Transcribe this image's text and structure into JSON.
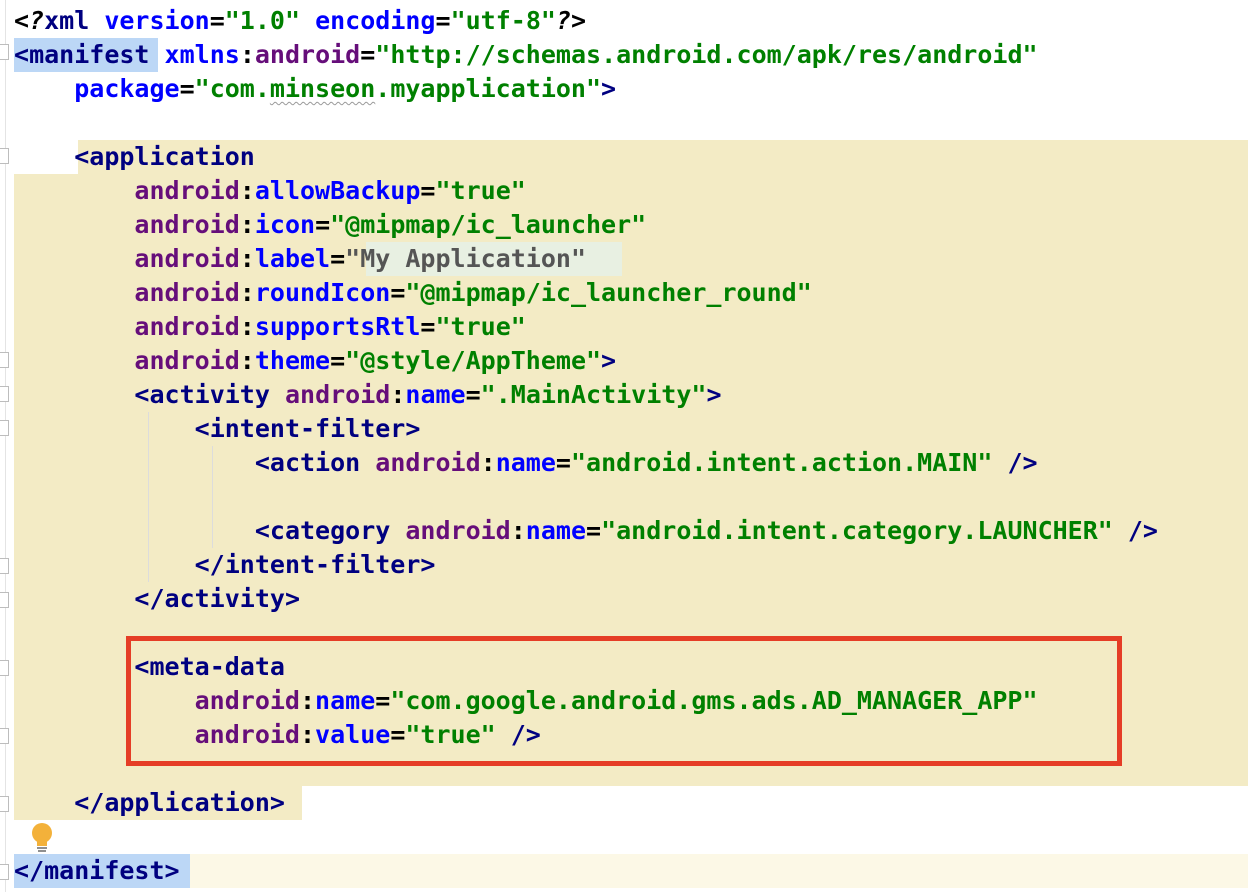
{
  "editor": {
    "language": "xml",
    "file_kind": "AndroidManifest",
    "line_texts": [
      "<?xml version=\"1.0\" encoding=\"utf-8\"?>",
      "<manifest xmlns:android=\"http://schemas.android.com/apk/res/android\"",
      "    package=\"com.minseon.myapplication\">",
      "",
      "    <application",
      "        android:allowBackup=\"true\"",
      "        android:icon=\"@mipmap/ic_launcher\"",
      "        android:label=\"My Application\"",
      "        android:roundIcon=\"@mipmap/ic_launcher_round\"",
      "        android:supportsRtl=\"true\"",
      "        android:theme=\"@style/AppTheme\">",
      "        <activity android:name=\".MainActivity\">",
      "            <intent-filter>",
      "                <action android:name=\"android.intent.action.MAIN\" />",
      "",
      "                <category android:name=\"android.intent.category.LAUNCHER\" />",
      "            </intent-filter>",
      "        </activity>",
      "",
      "        <meta-data",
      "            android:name=\"com.google.android.gms.ads.AD_MANAGER_APP\"",
      "            android:value=\"true\" />",
      "",
      "    </application>",
      "",
      "</manifest>"
    ],
    "t": {
      "lt": "<",
      "gt": ">",
      "lt_slash": "</",
      "self_close": "/>",
      "sp_self_close": " />",
      "eq": "=",
      "colon": ":",
      "pi_open": "<?",
      "pi_close": "?>",
      "xml": "xml",
      "version_attr": "version",
      "version_val": "\"1.0\"",
      "encoding_attr": "encoding",
      "encoding_val": "\"utf-8\"",
      "manifest": "manifest",
      "xmlns": "xmlns",
      "android": "android",
      "xmlns_val": "\"http://schemas.android.com/apk/res/android\"",
      "package": "package",
      "package_val_q1": "\"com.",
      "package_val_sq": "minseon",
      "package_val_q2": ".myapplication\"",
      "application": "application",
      "allowBackup": "allowBackup",
      "true_val": "\"true\"",
      "icon": "icon",
      "icon_val": "\"@mipmap/ic_launcher\"",
      "label": "label",
      "label_val": "\"My Application\"",
      "roundIcon": "roundIcon",
      "roundIcon_val": "\"@mipmap/ic_launcher_round\"",
      "supportsRtl": "supportsRtl",
      "theme": "theme",
      "theme_val": "\"@style/AppTheme\"",
      "activity": "activity",
      "name": "name",
      "activity_name_val": "\".MainActivity\"",
      "intent_filter": "intent-filter",
      "action": "action",
      "action_val": "\"android.intent.action.MAIN\"",
      "category": "category",
      "category_val": "\"android.intent.category.LAUNCHER\"",
      "meta_data": "meta-data",
      "meta_name_val": "\"com.google.android.gms.ads.AD_MANAGER_APP\"",
      "value": "value"
    }
  },
  "colors": {
    "tag": "#000080",
    "namespace": "#660e7a",
    "attribute": "#0000ff",
    "string": "#008000",
    "application_block_bg": "#f3ebc5",
    "selection_bg": "#bcd7f6",
    "callout_border": "#e53d26",
    "bulb": "#f3b13a"
  },
  "icons": [
    "fold-marker-icon",
    "lightbulb-icon"
  ],
  "callout": {
    "target": "meta-data element"
  }
}
